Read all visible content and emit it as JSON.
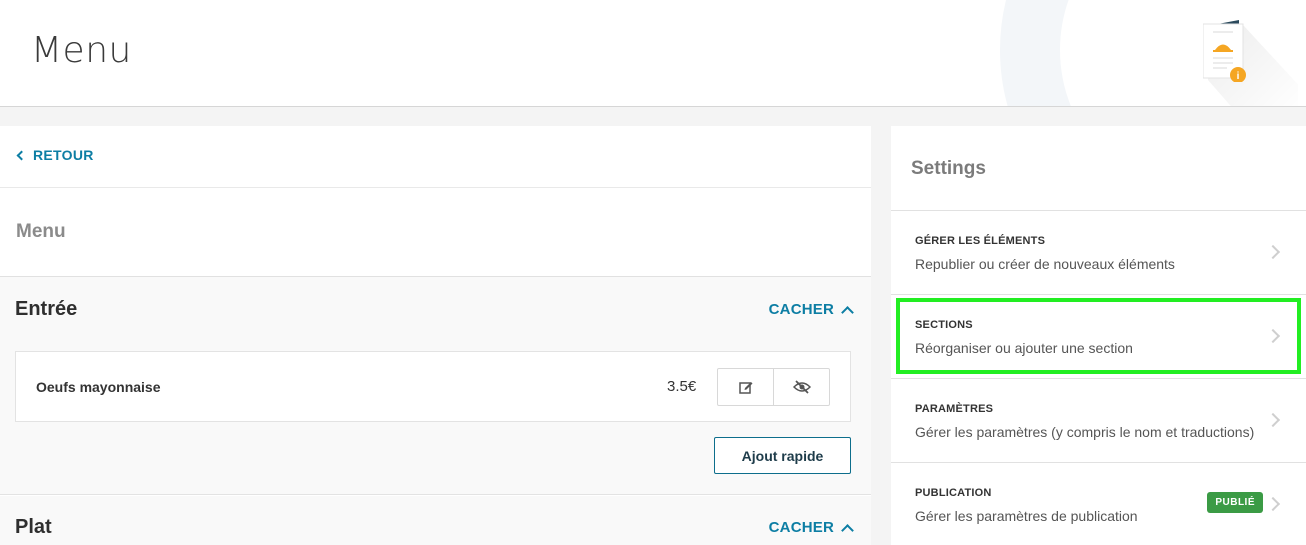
{
  "header": {
    "title": "Menu"
  },
  "left_panel": {
    "back_label": "RETOUR",
    "menu_heading": "Menu",
    "sections": [
      {
        "title": "Entrée",
        "toggle_label": "CACHER",
        "items": [
          {
            "name": "Oeufs mayonnaise",
            "price": "3.5€"
          }
        ],
        "quick_add_label": "Ajout rapide"
      },
      {
        "title": "Plat",
        "toggle_label": "CACHER"
      }
    ]
  },
  "settings": {
    "title": "Settings",
    "items": [
      {
        "label": "GÉRER LES ÉLÉMENTS",
        "description": "Republier ou créer de nouveaux éléments"
      },
      {
        "label": "SECTIONS",
        "description": "Réorganiser ou ajouter une section"
      },
      {
        "label": "PARAMÈTRES",
        "description": "Gérer les paramètres (y compris le nom et traductions)"
      },
      {
        "label": "PUBLICATION",
        "description": "Gérer les paramètres de publication",
        "badge": "PUBLIÉ"
      }
    ]
  },
  "colors": {
    "accent": "#0d7ea4",
    "highlight": "#22ee22",
    "badge_green": "#3b9b45",
    "info_orange": "#f5a623"
  },
  "icons": {
    "back": "chevron-left-icon",
    "toggle": "chevron-up-icon",
    "edit": "edit-icon",
    "hide": "eye-slash-icon",
    "settings_row": "chevron-right-icon",
    "header_illustration": "menu-document-icon",
    "info": "info-icon"
  }
}
